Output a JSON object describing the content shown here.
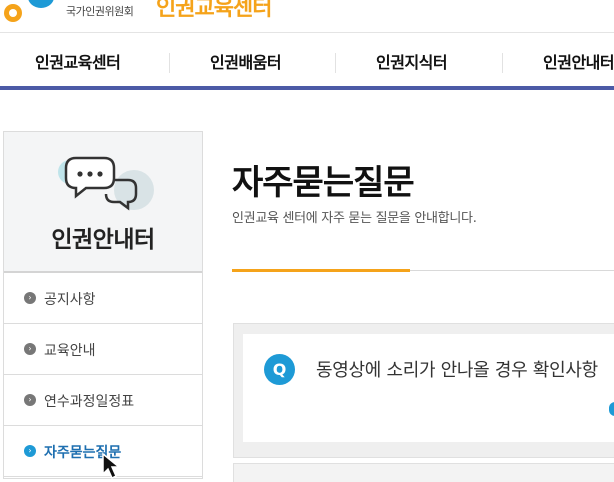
{
  "header": {
    "org_name": "국가인권위원회",
    "logo_text": "인권교육센터"
  },
  "gnb": {
    "items": [
      {
        "label": "인권교육센터"
      },
      {
        "label": "인권배움터"
      },
      {
        "label": "인권지식터"
      },
      {
        "label": "인권안내터"
      }
    ]
  },
  "side": {
    "title": "인권안내터",
    "icon": "chat-bubbles-icon",
    "items": [
      {
        "label": "공지사항",
        "active": false
      },
      {
        "label": "교육안내",
        "active": false
      },
      {
        "label": "연수과정일정표",
        "active": false
      },
      {
        "label": "자주묻는질문",
        "active": true
      }
    ]
  },
  "main": {
    "title": "자주묻는질문",
    "description": "인권교육 센터에 자주 묻는 질문을 안내합니다.",
    "faq": [
      {
        "badge": "Q",
        "question": "동영상에 소리가 안나올 경우 확인사항"
      }
    ]
  },
  "colors": {
    "accent_blue": "#1e9ad6",
    "accent_orange": "#f5a31a",
    "nav_border": "#4c5aa6"
  }
}
